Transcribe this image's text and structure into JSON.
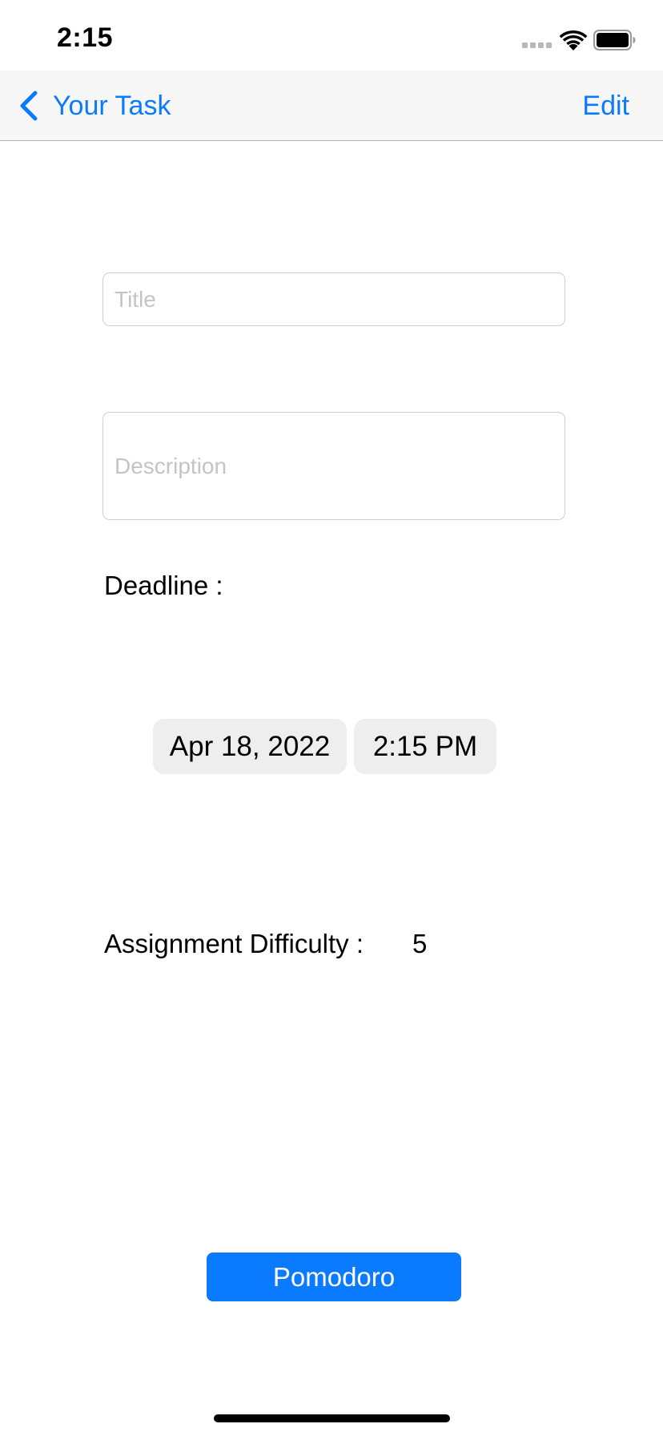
{
  "status_bar": {
    "time": "2:15",
    "icons": [
      "signal-icon",
      "wifi-icon",
      "battery-icon"
    ]
  },
  "nav": {
    "back_label": "Your Task",
    "back_icon": "chevron-left-icon",
    "edit_label": "Edit"
  },
  "form": {
    "title_placeholder": "Title",
    "title_value": "",
    "description_placeholder": "Description",
    "description_value": "",
    "deadline_label": "Deadline :",
    "deadline_date": "Apr 18, 2022",
    "deadline_time": "2:15 PM",
    "difficulty_label": "Assignment Difficulty :",
    "difficulty_value": "5"
  },
  "actions": {
    "pomodoro_label": "Pomodoro"
  },
  "colors": {
    "accent": "#0a7aff",
    "nav_background": "#f7f7f7",
    "pill_background": "#eeeeef",
    "placeholder": "#c4c4c6"
  }
}
